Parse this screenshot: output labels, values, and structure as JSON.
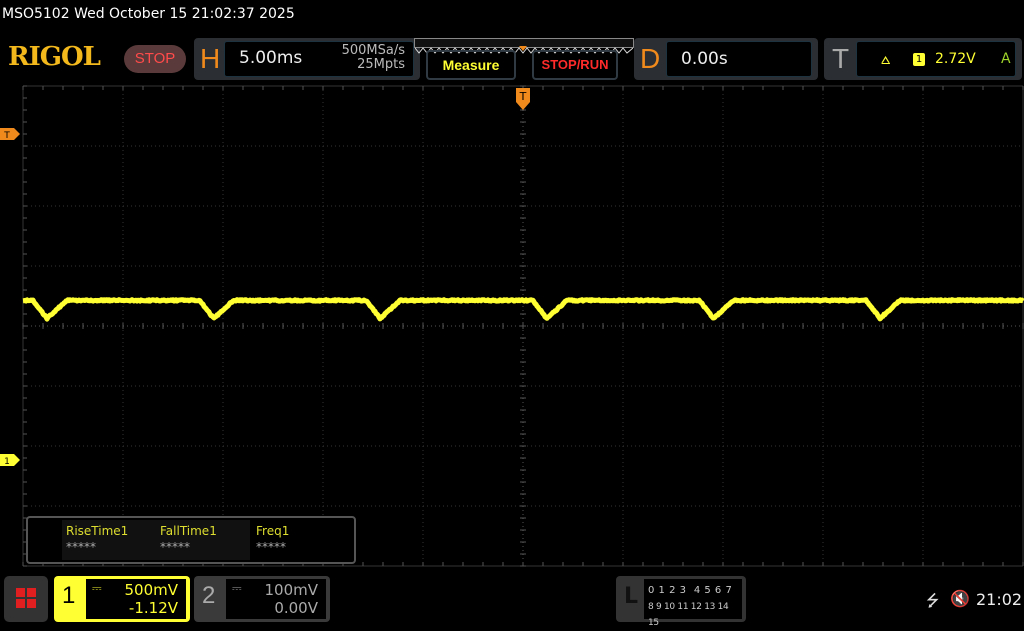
{
  "header": {
    "title": "MSO5102  Wed October 15 21:02:37 2025",
    "logo": "RIGOL",
    "run_state": "STOP"
  },
  "horizontal": {
    "label": "H",
    "timebase": "5.00ms",
    "sample_rate": "500MSa/s",
    "memory_depth": "25Mpts"
  },
  "buttons": {
    "measure": "Measure",
    "stop_run": "STOP/RUN"
  },
  "delay": {
    "label": "D",
    "value": "0.00s"
  },
  "trigger": {
    "label": "T",
    "slope_icon": "rising-edge-icon",
    "source": "1",
    "level": "2.72V",
    "mode": "A",
    "marker": "T"
  },
  "measurements": [
    {
      "name": "RiseTime1",
      "value": "*****"
    },
    {
      "name": "FallTime1",
      "value": "*****"
    },
    {
      "name": "Freq1",
      "value": "*****"
    }
  ],
  "channels": [
    {
      "num": "1",
      "scale": "500mV",
      "offset": "-1.12V",
      "color": "#ffff33",
      "active": true
    },
    {
      "num": "2",
      "scale": "100mV",
      "offset": "0.00V",
      "color": "#aaaaaa",
      "active": false
    }
  ],
  "logic": {
    "label": "L",
    "row1": "0 1 2 3  4 5 6 7",
    "row2": "8 9 10 11 12 13 14 15"
  },
  "status": {
    "usb_icon": "usb-icon",
    "sound_icon": "speaker-muted-icon",
    "time": "21:02"
  },
  "markers": {
    "ch1_ground": "1",
    "trigger_level": "T"
  },
  "waveform": {
    "channel": "1",
    "volts_per_div": 0.5,
    "ms_per_div": 5,
    "level_v": 1.33,
    "dip_v": 1.18,
    "period_ms": 8.33,
    "first_dip_ms": -23.8,
    "color": "#ffff33"
  }
}
